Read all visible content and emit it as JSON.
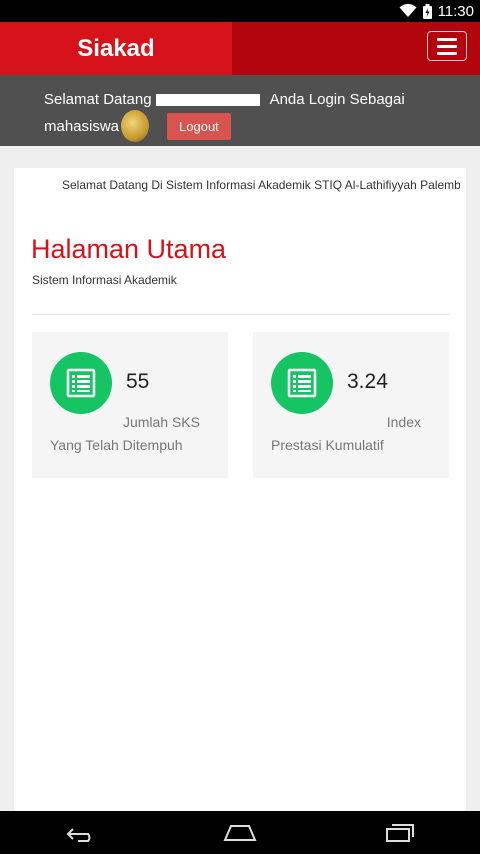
{
  "status_bar": {
    "time": "11:30"
  },
  "header": {
    "brand": "Siakad"
  },
  "welcome": {
    "greeting": "Selamat Datang",
    "login_as": "Anda Login Sebagai",
    "role": "mahasiswa",
    "logout_label": "Logout"
  },
  "main": {
    "marquee_text": "Selamat Datang Di Sistem Informasi Akademik STIQ Al-Lathifiyyah Palembang",
    "title": "Halaman Utama",
    "subtitle": "Sistem Informasi Akademik",
    "stats": [
      {
        "value": "55",
        "label_line1": "Jumlah SKS",
        "label_line2": "Yang Telah Ditempuh"
      },
      {
        "value": "3.24",
        "label_line1": "Index",
        "label_line2": "Prestasi Kumulatif"
      }
    ]
  },
  "colors": {
    "brand_red": "#d6121b",
    "header_dark_red": "#b3050d",
    "icon_green": "#15c463",
    "logout_red": "#d9534f"
  }
}
